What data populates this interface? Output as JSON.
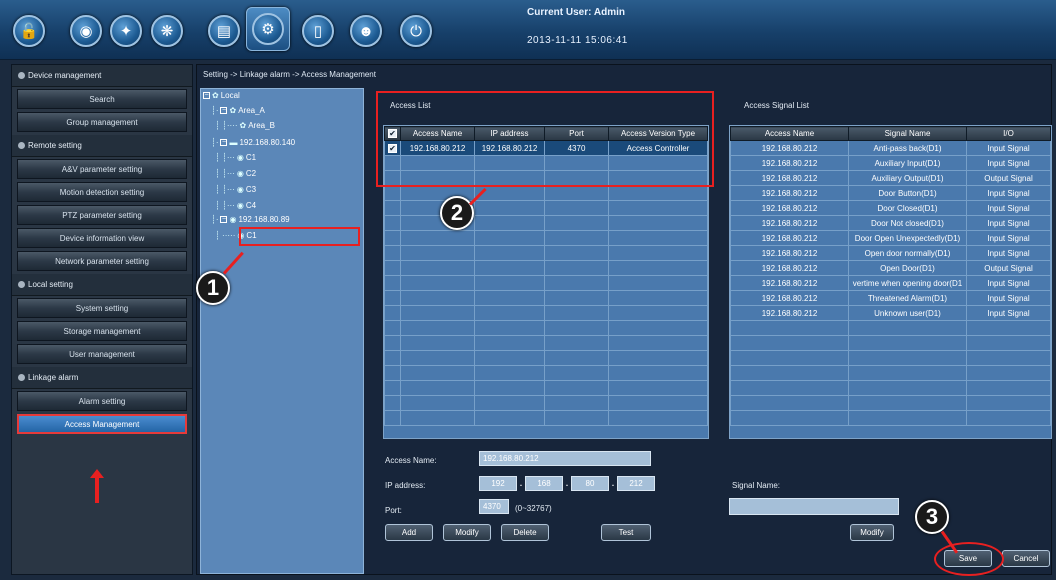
{
  "toolbar": {
    "icons": [
      {
        "name": "lock-icon",
        "glyph": "🔓"
      },
      {
        "name": "camera-icon",
        "glyph": "◉"
      },
      {
        "name": "map-icon",
        "glyph": "✦"
      },
      {
        "name": "gear-network-icon",
        "glyph": "❋"
      },
      {
        "name": "search-log-icon",
        "glyph": "▤"
      },
      {
        "name": "settings-icon",
        "glyph": "⚙"
      },
      {
        "name": "door-icon",
        "glyph": "▯"
      },
      {
        "name": "face-icon",
        "glyph": "☻"
      },
      {
        "name": "power-icon",
        "glyph": "⏻"
      }
    ],
    "current_user": "Current User: Admin",
    "datetime": "2013-11-11 15:06:41"
  },
  "sidebar": {
    "sections": {
      "device_management": "Device management",
      "remote_setting": "Remote setting",
      "local_setting": "Local setting",
      "linkage_alarm": "Linkage alarm"
    },
    "items": {
      "search": "Search",
      "group_management": "Group management",
      "av_parameter": "A&V parameter setting",
      "motion_detection": "Motion detection setting",
      "ptz_parameter": "PTZ parameter setting",
      "device_information": "Device information view",
      "network_parameter": "Network parameter setting",
      "system_setting": "System setting",
      "storage_management": "Storage management",
      "user_management": "User management",
      "alarm_setting": "Alarm setting",
      "access_management": "Access Management"
    }
  },
  "breadcrumb": "Setting -> Linkage alarm -> Access Management",
  "tree": {
    "root": "Local",
    "area_a": "Area_A",
    "area_b": "Area_B",
    "dev1": "192.168.80.140",
    "c1": "C1",
    "c2": "C2",
    "c3": "C3",
    "c4": "C4",
    "dev2": "192.168.80.89",
    "dev2_c1": "C1"
  },
  "access_list": {
    "title": "Access List",
    "columns": [
      "Access Name",
      "IP address",
      "Port",
      "Access Version Type"
    ],
    "rows": [
      [
        "192.168.80.212",
        "192.168.80.212",
        "4370",
        "Access Controller"
      ]
    ]
  },
  "signal_list": {
    "title": "Access Signal List",
    "columns": [
      "Access Name",
      "Signal Name",
      "I/O"
    ],
    "rows": [
      [
        "192.168.80.212",
        "Anti-pass back(D1)",
        "Input Signal"
      ],
      [
        "192.168.80.212",
        "Auxiliary Input(D1)",
        "Input Signal"
      ],
      [
        "192.168.80.212",
        "Auxiliary Output(D1)",
        "Output Signal"
      ],
      [
        "192.168.80.212",
        "Door Button(D1)",
        "Input Signal"
      ],
      [
        "192.168.80.212",
        "Door Closed(D1)",
        "Input Signal"
      ],
      [
        "192.168.80.212",
        "Door Not closed(D1)",
        "Input Signal"
      ],
      [
        "192.168.80.212",
        "Door Open Unexpectedly(D1)",
        "Input Signal"
      ],
      [
        "192.168.80.212",
        "Open door normally(D1)",
        "Input Signal"
      ],
      [
        "192.168.80.212",
        "Open Door(D1)",
        "Output Signal"
      ],
      [
        "192.168.80.212",
        "vertime when opening door(D1",
        "Input Signal"
      ],
      [
        "192.168.80.212",
        "Threatened Alarm(D1)",
        "Input Signal"
      ],
      [
        "192.168.80.212",
        "Unknown user(D1)",
        "Input Signal"
      ]
    ]
  },
  "form": {
    "access_name_label": "Access Name:",
    "access_name_value": "192.168.80.212",
    "ip_label": "IP address:",
    "ip": [
      "192",
      "168",
      "80",
      "212"
    ],
    "port_label": "Port:",
    "port_value": "4370",
    "port_range": "(0~32767)",
    "signal_name_label": "Signal Name:",
    "signal_name_value": ""
  },
  "buttons": {
    "add": "Add",
    "modify": "Modify",
    "delete": "Delete",
    "test": "Test",
    "signal_modify": "Modify",
    "save": "Save",
    "cancel": "Cancel"
  },
  "callouts": [
    "1",
    "2",
    "3"
  ],
  "colors": {
    "highlight_red": "#e82020",
    "accent_blue": "#2465a6"
  }
}
